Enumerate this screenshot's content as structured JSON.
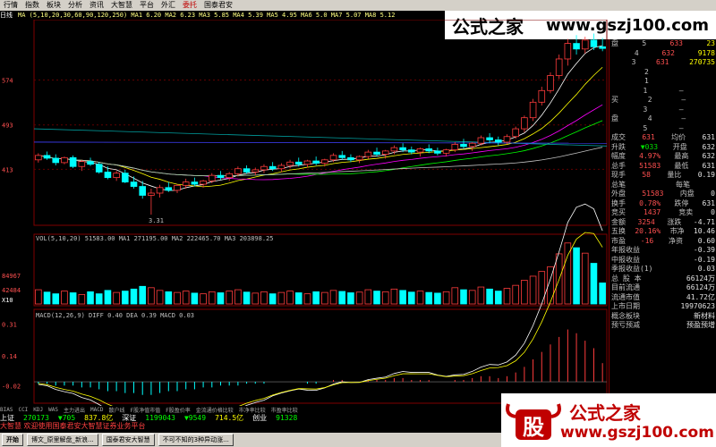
{
  "menu": [
    "行情",
    "指数",
    "板块",
    "分析",
    "资讯",
    "大智慧",
    "平台",
    "外汇",
    "委托",
    "国泰君安"
  ],
  "chart": {
    "indicator_ma": "MA (5,10,20,30,60,90,120,250)  MA1 6.20  MA2 6.23  MA3 5.85  MA4 5.39  MA5 4.95  MA6 5.0  MA7 5.07  MA8 5.12",
    "period_label": "日线",
    "price_top": "574",
    "price_mid": "493",
    "price_low": "413",
    "price_min": "3.31",
    "vol_label": "VOL(5,10,20)  51583.00  MA1 271195.00  MA2 222465.70  MA3 203898.25",
    "vol_top": "84967",
    "vol_mid": "42484",
    "vol_unit": "X10",
    "macd_label": "MACD(12,26,9)  DIFF 0.40  DEA 0.39  MACD 0.03",
    "macd_top": "0.31",
    "macd_mid": "0.14",
    "macd_low": "-0.02"
  },
  "chart_data": {
    "type": "candlestick",
    "ohlc": [
      [
        4.3,
        4.42,
        4.25,
        4.38
      ],
      [
        4.38,
        4.45,
        4.3,
        4.33
      ],
      [
        4.33,
        4.4,
        4.2,
        4.25
      ],
      [
        4.25,
        4.36,
        4.22,
        4.34
      ],
      [
        4.34,
        4.38,
        4.15,
        4.18
      ],
      [
        4.18,
        4.3,
        4.1,
        4.27
      ],
      [
        4.27,
        4.34,
        4.19,
        4.22
      ],
      [
        4.22,
        4.26,
        4.05,
        4.08
      ],
      [
        4.08,
        4.18,
        3.95,
        3.98
      ],
      [
        3.98,
        4.1,
        3.92,
        4.06
      ],
      [
        4.06,
        4.12,
        3.88,
        3.9
      ],
      [
        3.9,
        4.0,
        3.78,
        3.82
      ],
      [
        3.82,
        3.92,
        3.6,
        3.66
      ],
      [
        3.66,
        3.78,
        3.31,
        3.7
      ],
      [
        3.7,
        3.85,
        3.62,
        3.8
      ],
      [
        3.8,
        3.9,
        3.72,
        3.75
      ],
      [
        3.75,
        3.86,
        3.7,
        3.84
      ],
      [
        3.84,
        3.96,
        3.78,
        3.9
      ],
      [
        3.9,
        3.98,
        3.82,
        3.86
      ],
      [
        3.86,
        3.94,
        3.8,
        3.92
      ],
      [
        3.92,
        4.06,
        3.88,
        4.02
      ],
      [
        4.02,
        4.1,
        3.94,
        3.98
      ],
      [
        3.98,
        4.08,
        3.92,
        4.05
      ],
      [
        4.05,
        4.18,
        4.0,
        4.14
      ],
      [
        4.14,
        4.2,
        4.05,
        4.08
      ],
      [
        4.08,
        4.16,
        4.02,
        4.12
      ],
      [
        4.12,
        4.22,
        4.06,
        4.18
      ],
      [
        4.18,
        4.26,
        4.1,
        4.14
      ],
      [
        4.14,
        4.24,
        4.08,
        4.2
      ],
      [
        4.2,
        4.3,
        4.15,
        4.26
      ],
      [
        4.26,
        4.34,
        4.18,
        4.22
      ],
      [
        4.22,
        4.3,
        4.16,
        4.28
      ],
      [
        4.28,
        4.36,
        4.2,
        4.24
      ],
      [
        4.24,
        4.32,
        4.18,
        4.3
      ],
      [
        4.3,
        4.42,
        4.26,
        4.38
      ],
      [
        4.38,
        4.46,
        4.3,
        4.34
      ],
      [
        4.34,
        4.4,
        4.26,
        4.3
      ],
      [
        4.3,
        4.38,
        4.24,
        4.36
      ],
      [
        4.36,
        4.48,
        4.32,
        4.44
      ],
      [
        4.44,
        4.52,
        4.36,
        4.4
      ],
      [
        4.4,
        4.48,
        4.32,
        4.46
      ],
      [
        4.46,
        4.56,
        4.4,
        4.52
      ],
      [
        4.52,
        4.6,
        4.44,
        4.48
      ],
      [
        4.48,
        4.54,
        4.4,
        4.44
      ],
      [
        4.44,
        4.52,
        4.36,
        4.5
      ],
      [
        4.5,
        4.58,
        4.42,
        4.46
      ],
      [
        4.46,
        4.52,
        4.38,
        4.42
      ],
      [
        4.42,
        4.5,
        4.36,
        4.48
      ],
      [
        4.48,
        4.62,
        4.44,
        4.58
      ],
      [
        4.58,
        4.68,
        4.5,
        4.54
      ],
      [
        4.54,
        4.62,
        4.46,
        4.6
      ],
      [
        4.6,
        4.74,
        4.56,
        4.7
      ],
      [
        4.7,
        4.78,
        4.6,
        4.66
      ],
      [
        4.66,
        4.72,
        4.56,
        4.62
      ],
      [
        4.62,
        4.76,
        4.58,
        4.72
      ],
      [
        4.72,
        4.9,
        4.68,
        4.86
      ],
      [
        4.86,
        5.1,
        4.8,
        5.06
      ],
      [
        5.06,
        5.4,
        5.0,
        5.34
      ],
      [
        5.34,
        5.62,
        5.28,
        5.55
      ],
      [
        5.55,
        5.88,
        5.5,
        5.82
      ],
      [
        5.82,
        6.2,
        5.76,
        6.12
      ],
      [
        6.12,
        6.48,
        6.0,
        6.4
      ],
      [
        6.4,
        6.55,
        6.2,
        6.3
      ],
      [
        6.3,
        6.52,
        6.22,
        6.46
      ],
      [
        6.46,
        6.58,
        6.28,
        6.34
      ],
      [
        6.34,
        6.5,
        6.26,
        6.31
      ]
    ],
    "volume": [
      42,
      35,
      30,
      38,
      33,
      28,
      36,
      30,
      40,
      34,
      38,
      44,
      52,
      48,
      40,
      36,
      34,
      38,
      32,
      30,
      36,
      33,
      38,
      42,
      35,
      32,
      36,
      30,
      34,
      38,
      33,
      30,
      36,
      34,
      40,
      37,
      33,
      35,
      42,
      38,
      36,
      44,
      40,
      35,
      38,
      34,
      32,
      36,
      48,
      42,
      40,
      50,
      44,
      38,
      46,
      55,
      70,
      82,
      96,
      110,
      148,
      180,
      166,
      150,
      120,
      62
    ],
    "macd_hist": [
      -0.01,
      -0.01,
      -0.02,
      -0.02,
      -0.02,
      -0.03,
      -0.03,
      -0.04,
      -0.05,
      -0.05,
      -0.06,
      -0.06,
      -0.07,
      -0.07,
      -0.06,
      -0.05,
      -0.05,
      -0.04,
      -0.04,
      -0.03,
      -0.03,
      -0.02,
      -0.02,
      -0.02,
      -0.01,
      -0.01,
      -0.01,
      0.0,
      0.0,
      0.0,
      0.0,
      -0.01,
      -0.01,
      0.0,
      0.01,
      0.01,
      0.0,
      0.0,
      0.01,
      0.01,
      0.01,
      0.02,
      0.02,
      0.01,
      0.01,
      0.01,
      0.0,
      0.0,
      0.01,
      0.01,
      0.02,
      0.03,
      0.03,
      0.02,
      0.03,
      0.05,
      0.08,
      0.12,
      0.16,
      0.2,
      0.24,
      0.28,
      0.26,
      0.22,
      0.18,
      0.1
    ]
  },
  "quote": {
    "sell": [
      [
        "633",
        "23"
      ],
      [
        "632",
        "9178"
      ],
      [
        "631",
        "270735"
      ],
      [
        "",
        ""
      ],
      [
        "",
        ""
      ]
    ],
    "sell_label": "盘",
    "buy_label": "买",
    "buy_label2": "盘",
    "rows": [
      {
        "l": "成交",
        "v": "631",
        "l2": "均价",
        "v2": "631"
      },
      {
        "l": "升跌",
        "v": "▼033",
        "l2": "开盘",
        "v2": "632"
      },
      {
        "l": "幅度",
        "v": "4.97%",
        "l2": "最高",
        "v2": "632"
      },
      {
        "l": "总手",
        "v": "51583",
        "l2": "最低",
        "v2": "631"
      },
      {
        "l": "现手",
        "v": "58",
        "l2": "量比",
        "v2": "0.19"
      },
      {
        "l": "总笔",
        "v": "",
        "l2": "每笔",
        "v2": ""
      },
      {
        "l": "外盘",
        "v": "51583",
        "l2": "内盘",
        "v2": "0"
      },
      {
        "l": "换手",
        "v": "0.78%",
        "l2": "跌停",
        "v2": "631"
      },
      {
        "l": "竞买",
        "v": "1437",
        "l2": "竞卖",
        "v2": "0"
      },
      {
        "l": "金额",
        "v": "3254",
        "l2": "涨跌",
        "v2": "-4.71"
      },
      {
        "l": "五换",
        "v": "20.16%",
        "l2": "市净",
        "v2": "10.46"
      },
      {
        "l": "市盈",
        "v": "-16",
        "l2": "净资",
        "v2": "0.60"
      }
    ],
    "fin": [
      {
        "l": "年报收益",
        "v": "-0.39"
      },
      {
        "l": "中报收益",
        "v": "-0.19"
      },
      {
        "l": "季报收益(1)",
        "v": "0.03"
      },
      {
        "l": "总 股 本",
        "v": "66124万"
      },
      {
        "l": "目前流通",
        "v": "66124万"
      },
      {
        "l": "流通市值",
        "v": "41.72亿"
      },
      {
        "l": "上市日期",
        "v": "19970623"
      },
      {
        "l": "概念板块",
        "v": "新材料"
      },
      {
        "l": "预亏预减",
        "v": "预盈预增"
      }
    ]
  },
  "tabs": [
    "BIAS",
    "CCI",
    "KDJ",
    "WAS",
    "主力进出",
    "MACD",
    "散户线",
    "F股净值市值",
    "F股盈价率",
    "金流通价格比较",
    "市净率比较",
    "市盈率比较"
  ],
  "status": {
    "index1_name": "上证",
    "index1_val": "270173",
    "index1_chg": "▼705",
    "index1_amt": "837.8亿",
    "index2_name": "深证",
    "index2_val": "1199043",
    "index2_chg": "▼9549",
    "index2_amt": "714.5亿",
    "index3_name": "创业",
    "index3_val": "91328"
  },
  "scroll_text": "大智慧 欢迎使用国泰君安大智慧证券业务平台",
  "taskbar": {
    "start": "开始",
    "tasks": [
      "博文_原里解盘_新浪...",
      "国泰君安大智慧",
      "不可不知的3种异动涨..."
    ]
  },
  "watermark": {
    "cn": "公式之家",
    "url": "www.gszj100.com"
  },
  "logo": {
    "cn": "公式之家",
    "url": "www.gszj100.com"
  },
  "colors": {
    "up": "#ff3c3c",
    "down": "#00ffff",
    "bg": "#000000"
  }
}
